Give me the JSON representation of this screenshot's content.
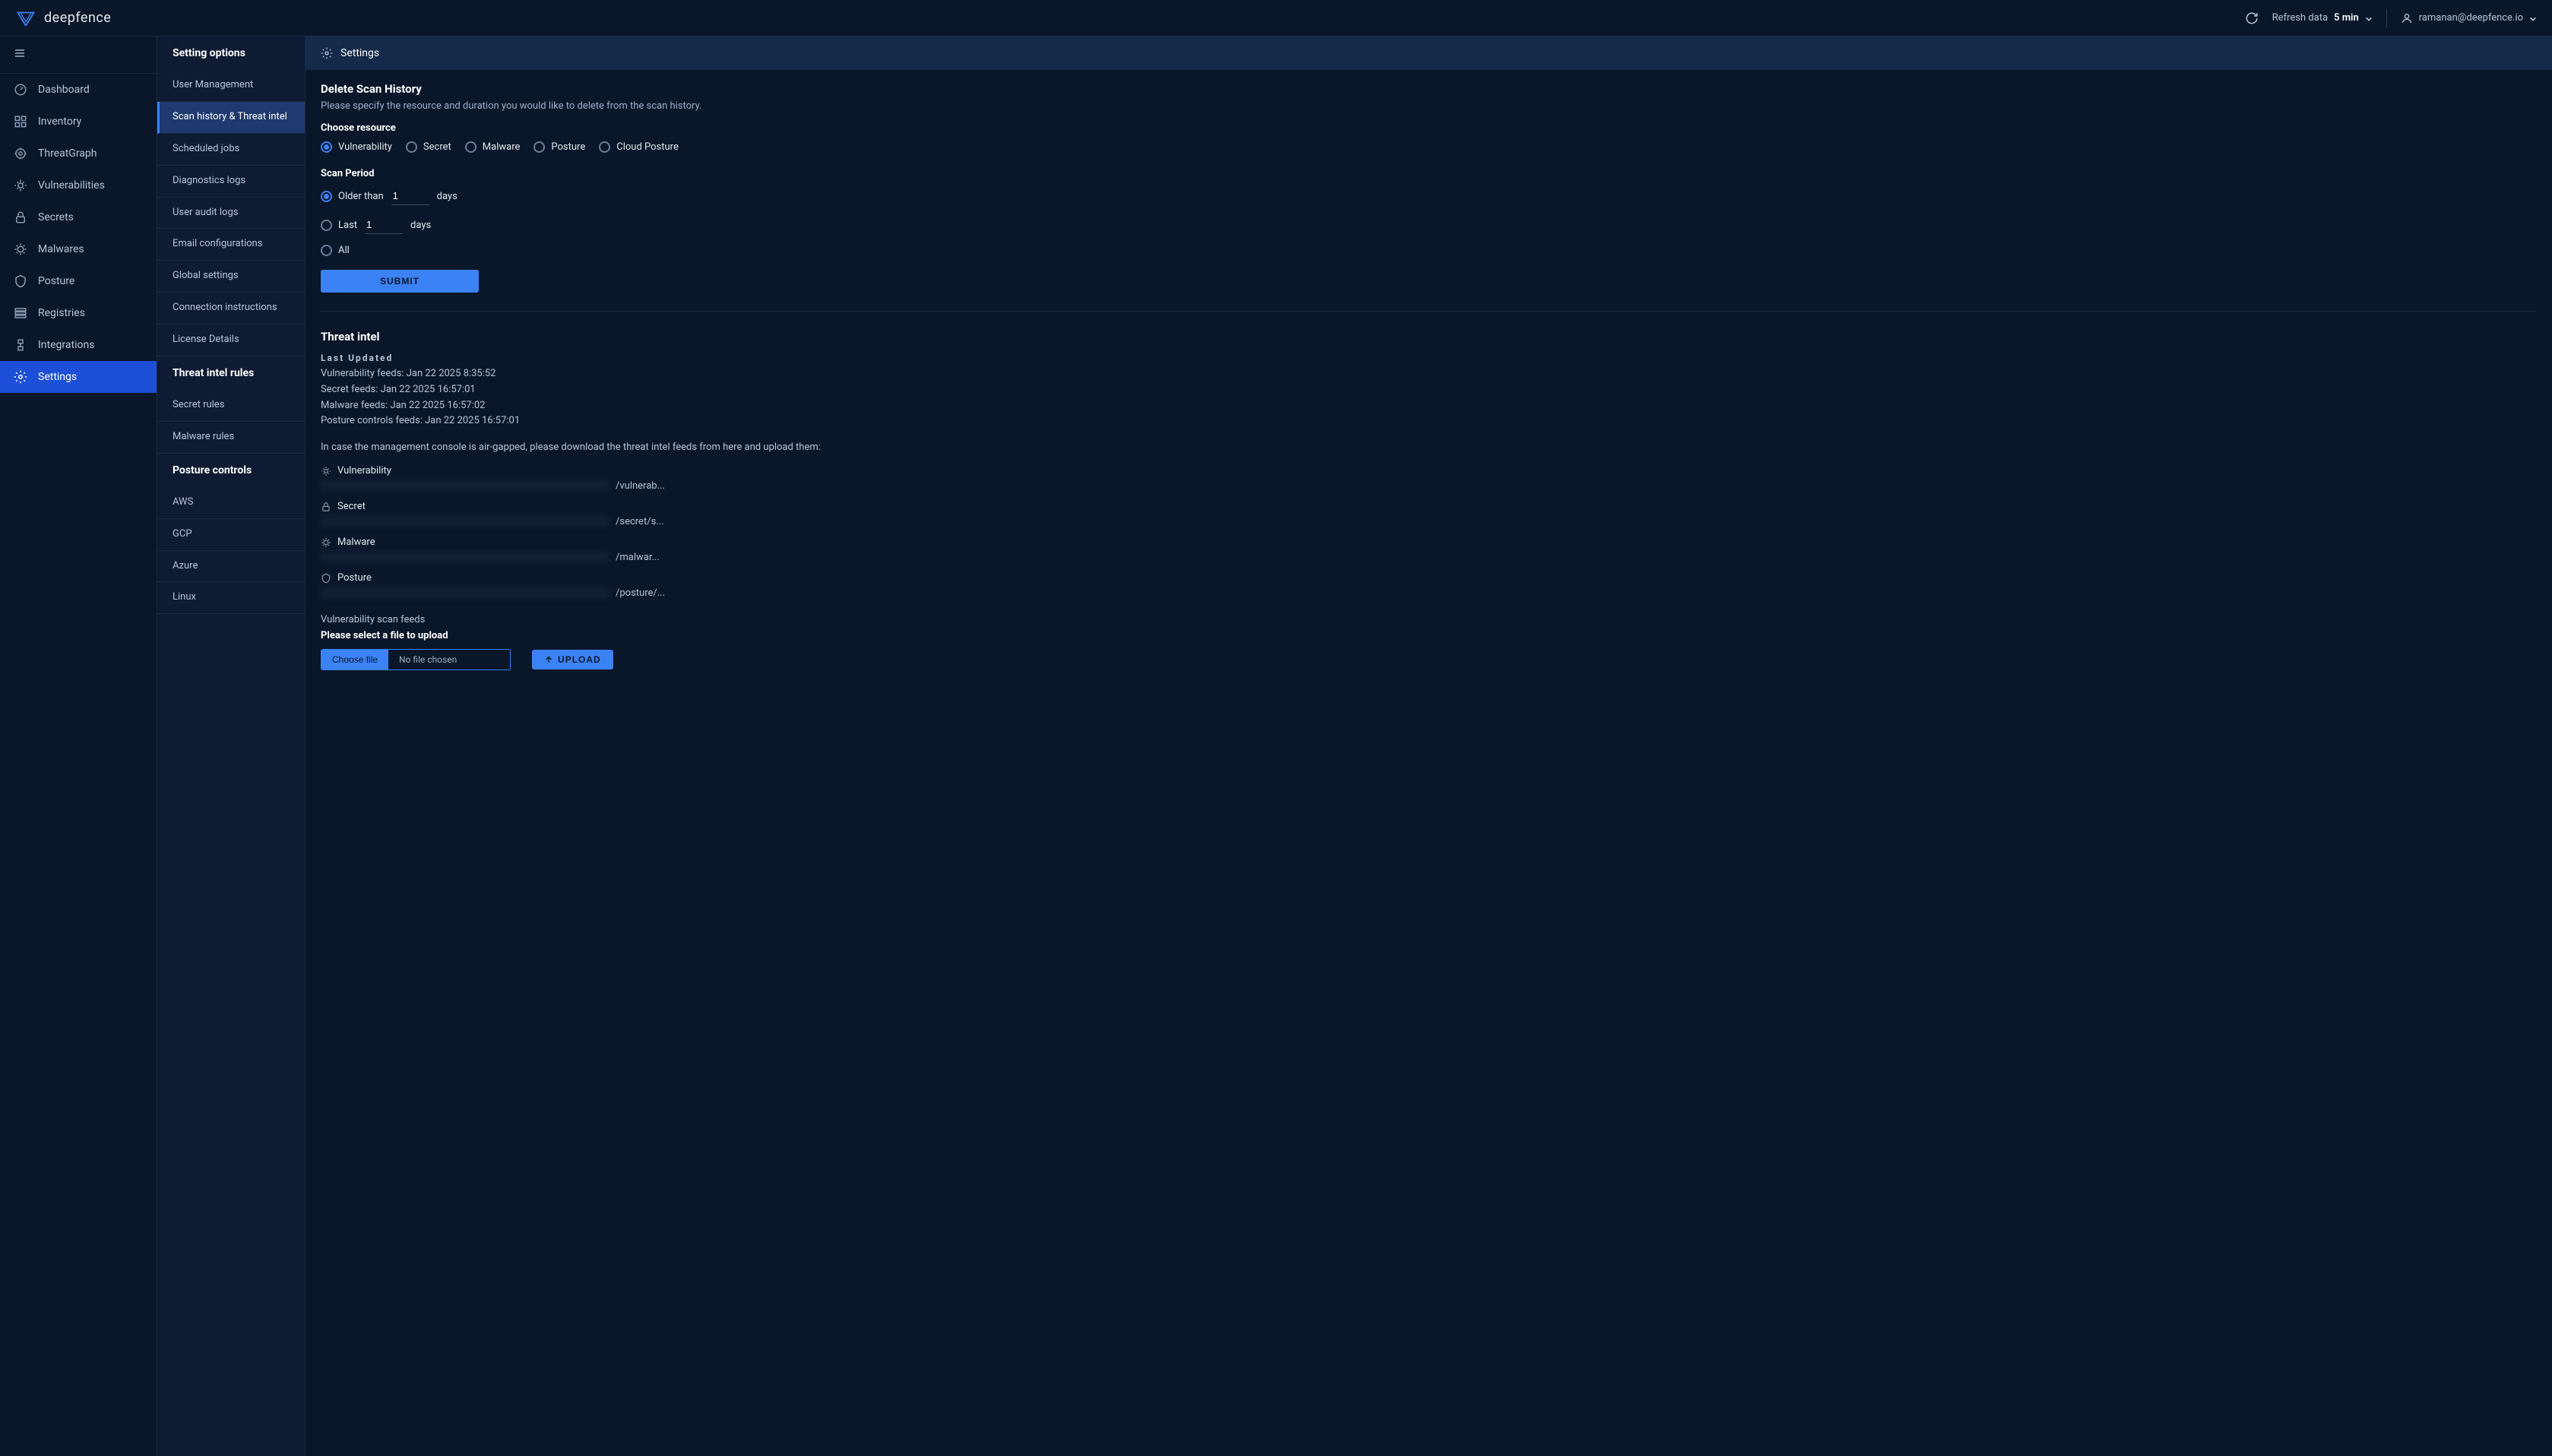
{
  "brand": "deepfence",
  "topbar": {
    "refresh_label": "Refresh data",
    "refresh_value": "5 min",
    "user_email": "ramanan@deepfence.io"
  },
  "nav": {
    "items": [
      {
        "label": "Dashboard",
        "icon": "dashboard-icon"
      },
      {
        "label": "Inventory",
        "icon": "inventory-icon"
      },
      {
        "label": "ThreatGraph",
        "icon": "threatgraph-icon"
      },
      {
        "label": "Vulnerabilities",
        "icon": "vulnerability-icon"
      },
      {
        "label": "Secrets",
        "icon": "lock-icon"
      },
      {
        "label": "Malwares",
        "icon": "malware-icon"
      },
      {
        "label": "Posture",
        "icon": "shield-icon"
      },
      {
        "label": "Registries",
        "icon": "registry-icon"
      },
      {
        "label": "Integrations",
        "icon": "integration-icon"
      },
      {
        "label": "Settings",
        "icon": "gear-icon",
        "active": true
      }
    ]
  },
  "subnav": {
    "groups": [
      {
        "header": "Setting options",
        "items": [
          {
            "label": "User Management"
          },
          {
            "label": "Scan history & Threat intel",
            "active": true
          },
          {
            "label": "Scheduled jobs"
          },
          {
            "label": "Diagnostics logs"
          },
          {
            "label": "User audit logs"
          },
          {
            "label": "Email configurations"
          },
          {
            "label": "Global settings"
          },
          {
            "label": "Connection instructions"
          },
          {
            "label": "License Details"
          }
        ]
      },
      {
        "header": "Threat intel rules",
        "items": [
          {
            "label": "Secret rules"
          },
          {
            "label": "Malware rules"
          }
        ]
      },
      {
        "header": "Posture controls",
        "items": [
          {
            "label": "AWS"
          },
          {
            "label": "GCP"
          },
          {
            "label": "Azure"
          },
          {
            "label": "Linux"
          }
        ]
      }
    ]
  },
  "page": {
    "header_title": "Settings",
    "delete_history": {
      "title": "Delete Scan History",
      "desc": "Please specify the resource and duration you would like to delete from the scan history.",
      "choose_label": "Choose resource",
      "resources": [
        {
          "label": "Vulnerability",
          "checked": true
        },
        {
          "label": "Secret"
        },
        {
          "label": "Malware"
        },
        {
          "label": "Posture"
        },
        {
          "label": "Cloud Posture"
        }
      ],
      "period_label": "Scan Period",
      "older_than": "Older than",
      "older_value": "1",
      "last": "Last",
      "last_value": "1",
      "days": "days",
      "all": "All",
      "submit": "SUBMIT"
    },
    "threat_intel": {
      "title": "Threat intel",
      "last_updated_label": "Last Updated",
      "feeds": [
        "Vulnerability feeds: Jan 22 2025 8:35:52",
        "Secret feeds: Jan 22 2025 16:57:01",
        "Malware feeds: Jan 22 2025 16:57:02",
        "Posture controls feeds: Jan 22 2025 16:57:01"
      ],
      "airgap_note": "In case the management console is air-gapped, please download the threat intel feeds from here and upload them:",
      "downloads": [
        {
          "label": "Vulnerability",
          "icon": "vulnerability-icon",
          "tail": "/vulnerab..."
        },
        {
          "label": "Secret",
          "icon": "lock-icon",
          "tail": "/secret/s..."
        },
        {
          "label": "Malware",
          "icon": "malware-icon",
          "tail": "/malwar..."
        },
        {
          "label": "Posture",
          "icon": "shield-icon",
          "tail": "/posture/..."
        }
      ],
      "upload": {
        "heading": "Vulnerability scan feeds",
        "select_label": "Please select a file to upload",
        "choose_btn": "Choose file",
        "no_file": "No file chosen",
        "upload_btn": "UPLOAD"
      }
    }
  }
}
